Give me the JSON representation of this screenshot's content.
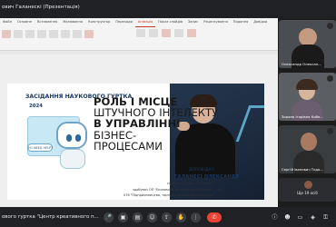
{
  "window": {
    "title": "ович Галанескі (Презентація)"
  },
  "ribbon": {
    "menu": [
      "Файл",
      "Основне",
      "Вставлення",
      "Малювання",
      "Конструктор",
      "Переходи",
      "Анімація",
      "Показ слайдів",
      "Запис",
      "Рецензування",
      "Подання",
      "Довідка"
    ],
    "active_index": 6
  },
  "slide": {
    "heading": "ЗАСІДАННЯ НАУКОВОГО ГУРТКА",
    "year": "2024",
    "title_lines": [
      "РОЛЬ І МІСЦЕ",
      "ШТУЧНОГО ІНТЕЛЕКТУ",
      "В УПРАВЛІННІ",
      "БІЗНЕС-",
      "ПРОЦЕСАМИ"
    ],
    "bubble": "HI! NEED HELP?",
    "speaker_label": "ДОПОВІДАЧ:",
    "speaker_name": "ГАЛАНЕСІ ОЛЕКСАНДР",
    "student": "студент 2 курсу, СН групи",
    "program1": "здобувач ОП \"Економіка та організація бізнесу\", спец.",
    "program2": "076 \"Підприємництво, торгівля та біржова діяльність\""
  },
  "participants": [
    {
      "name": "Олександр Олексан..."
    },
    {
      "name": "Зоряна Ігорівна Кобе..."
    },
    {
      "name": "Сергій Іванович Тодо..."
    }
  ],
  "others_label": "Ще 19 осіб",
  "meeting": {
    "name": "ового гуртка \"Центр креативного п..."
  },
  "controls": {
    "icons": [
      "mic-icon",
      "camera-icon",
      "captions-icon",
      "emoji-icon",
      "present-icon",
      "raise-hand-icon",
      "more-icon",
      "end-call-icon"
    ]
  },
  "right_controls": {
    "icons": [
      "info-icon",
      "people-icon",
      "chat-icon",
      "activities-icon",
      "lock-icon"
    ]
  },
  "colors": {
    "accent": "#1b3a63",
    "end": "#ea4335"
  }
}
